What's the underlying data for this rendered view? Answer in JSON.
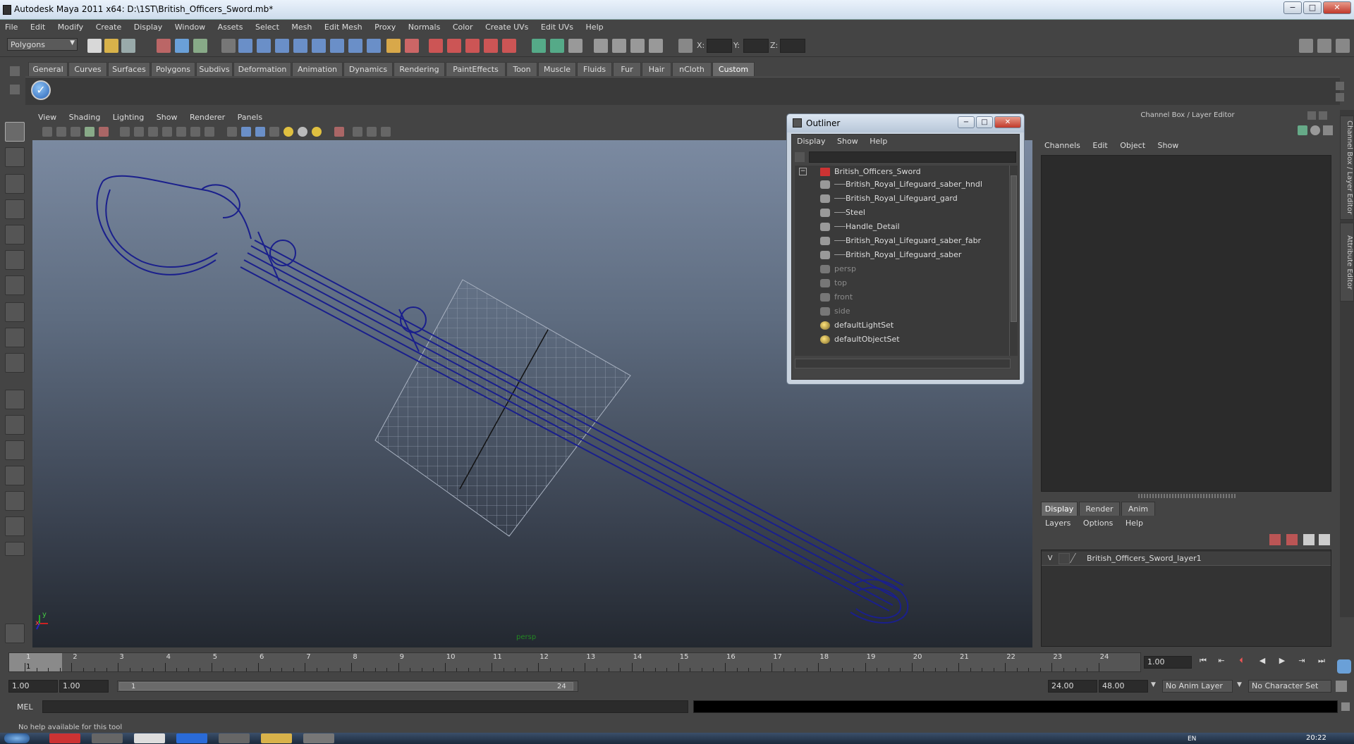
{
  "window": {
    "title": "Autodesk Maya 2011 x64: D:\\1ST\\British_Officers_Sword.mb*",
    "minimize": "−",
    "maximize": "□",
    "close": "✕"
  },
  "menubar": [
    "File",
    "Edit",
    "Modify",
    "Create",
    "Display",
    "Window",
    "Assets",
    "Select",
    "Mesh",
    "Edit Mesh",
    "Proxy",
    "Normals",
    "Color",
    "Create UVs",
    "Edit UVs",
    "Help"
  ],
  "toolbar": {
    "mode": "Polygons",
    "x_label": "X:",
    "y_label": "Y:",
    "z_label": "Z:"
  },
  "shelf_tabs": [
    "General",
    "Curves",
    "Surfaces",
    "Polygons",
    "Subdivs",
    "Deformation",
    "Animation",
    "Dynamics",
    "Rendering",
    "PaintEffects",
    "Toon",
    "Muscle",
    "Fluids",
    "Fur",
    "Hair",
    "nCloth",
    "Custom"
  ],
  "shelf_active": "Custom",
  "viewport": {
    "menu": [
      "View",
      "Shading",
      "Lighting",
      "Show",
      "Renderer",
      "Panels"
    ],
    "camera_label": "persp",
    "axis_x": "x",
    "axis_y": "y",
    "wire_color": "#1a1f8c"
  },
  "outliner": {
    "title": "Outliner",
    "menu": [
      "Display",
      "Show",
      "Help"
    ],
    "root": "British_Officers_Sword",
    "children": [
      "British_Royal_Lifeguard_saber_hndl",
      "British_Royal_Lifeguard_gard",
      "Steel",
      "Handle_Detail",
      "British_Royal_Lifeguard_saber_fabr",
      "British_Royal_Lifeguard_saber"
    ],
    "cameras": [
      "persp",
      "top",
      "front",
      "side"
    ],
    "sets": [
      "defaultLightSet",
      "defaultObjectSet"
    ],
    "collapse_symbol": "−"
  },
  "channel_box": {
    "title": "Channel Box / Layer Editor",
    "menu": [
      "Channels",
      "Edit",
      "Object",
      "Show"
    ],
    "tabs": [
      "Display",
      "Render",
      "Anim"
    ],
    "active_tab": "Display",
    "layer_menu": [
      "Layers",
      "Options",
      "Help"
    ],
    "layer": {
      "visible": "V",
      "name": "British_Officers_Sword_layer1"
    }
  },
  "side_tabs": [
    "Channel Box / Layer Editor",
    "Attribute Editor"
  ],
  "timeline": {
    "ticks": [
      "1",
      "2",
      "3",
      "4",
      "5",
      "6",
      "7",
      "8",
      "9",
      "10",
      "11",
      "12",
      "13",
      "14",
      "15",
      "16",
      "17",
      "18",
      "19",
      "20",
      "21",
      "22",
      "23",
      "24"
    ],
    "current_frame_marker": "1",
    "current_frame": "1.00",
    "playback": [
      "⏮",
      "⇤",
      "⏴",
      "◀",
      "▶",
      "⇥",
      "⏭"
    ]
  },
  "range": {
    "start_time": "1.00",
    "playback_start": "1.00",
    "slider_start": "1",
    "slider_end": "24",
    "playback_end": "24.00",
    "end_time": "48.00",
    "anim_layer": "No Anim Layer",
    "character_set": "No Character Set"
  },
  "command": {
    "label": "MEL"
  },
  "help_line": "No help available for this tool",
  "taskbar": {
    "clock": "20:22",
    "lang": "EN"
  }
}
